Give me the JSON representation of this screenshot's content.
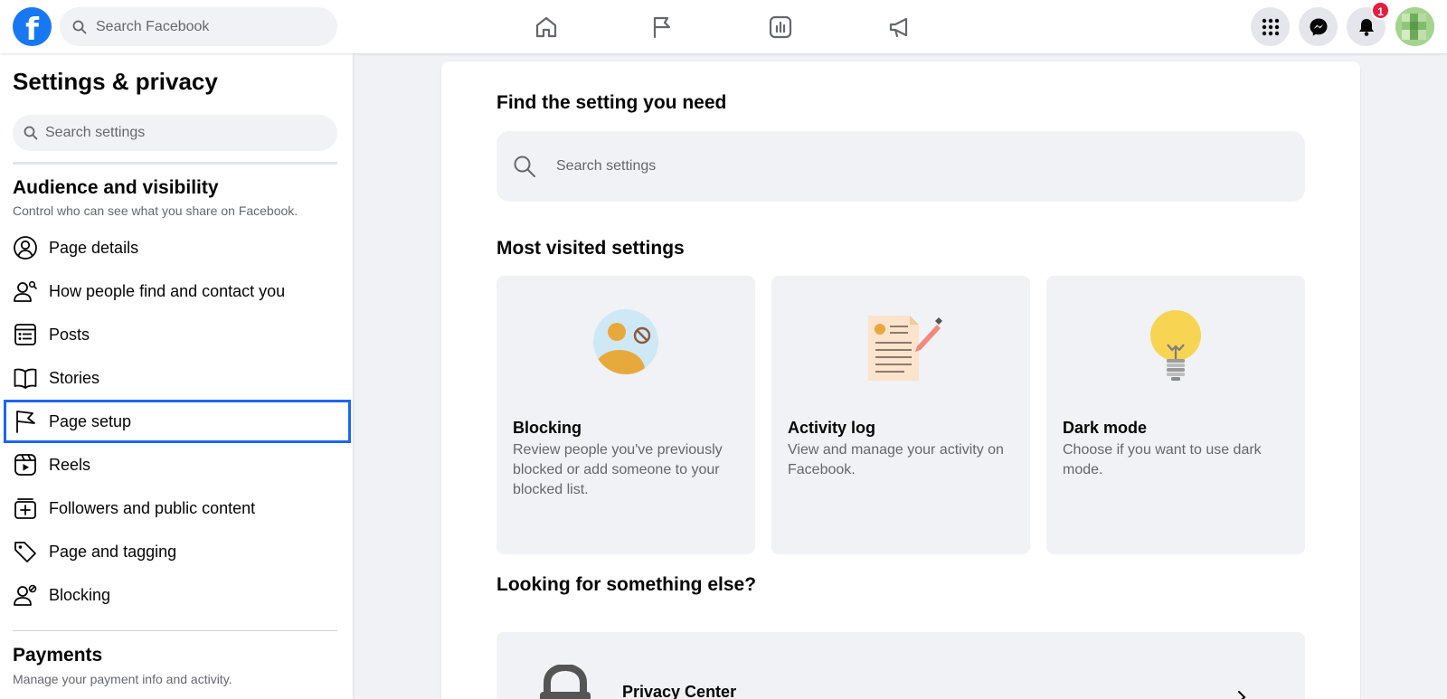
{
  "topbar": {
    "logo_letter": "f",
    "search_placeholder": "Search Facebook",
    "nav": [
      "home-icon",
      "flag-icon",
      "insights-icon",
      "megaphone-icon"
    ],
    "notification_count": "1"
  },
  "sidebar": {
    "title": "Settings & privacy",
    "search_placeholder": "Search settings",
    "section1": {
      "title": "Audience and visibility",
      "subtitle": "Control who can see what you share on Facebook."
    },
    "items": [
      {
        "label": "Page details",
        "icon": "person-circle-icon"
      },
      {
        "label": "How people find and contact you",
        "icon": "person-search-icon"
      },
      {
        "label": "Posts",
        "icon": "posts-icon"
      },
      {
        "label": "Stories",
        "icon": "book-icon"
      },
      {
        "label": "Page setup",
        "icon": "flag-icon"
      },
      {
        "label": "Reels",
        "icon": "reels-icon"
      },
      {
        "label": "Followers and public content",
        "icon": "followers-icon"
      },
      {
        "label": "Page and tagging",
        "icon": "tag-icon"
      },
      {
        "label": "Blocking",
        "icon": "person-block-icon"
      }
    ],
    "active_item": "Page setup",
    "section2": {
      "title": "Payments",
      "subtitle": "Manage your payment info and activity."
    }
  },
  "main": {
    "find_title": "Find the setting you need",
    "search_placeholder": "Search settings",
    "most_visited_title": "Most visited settings",
    "tiles": [
      {
        "title": "Blocking",
        "desc": "Review people you've previously blocked or add someone to your blocked list.",
        "icon": "blocking-illustration"
      },
      {
        "title": "Activity log",
        "desc": "View and manage your activity on Facebook.",
        "icon": "activity-log-illustration"
      },
      {
        "title": "Dark mode",
        "desc": "Choose if you want to use dark mode.",
        "icon": "lightbulb-illustration"
      }
    ],
    "else_title": "Looking for something else?",
    "privacy_center": "Privacy Center"
  },
  "colors": {
    "brand": "#1877f2",
    "active_outline": "#1b65f2",
    "badge": "#e41e3f",
    "background": "#f0f2f5"
  }
}
